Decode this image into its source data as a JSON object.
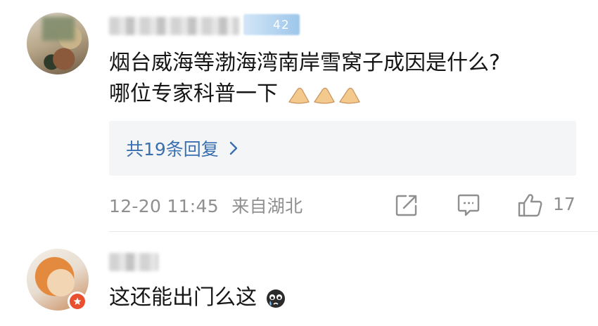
{
  "comments": [
    {
      "text_line1": "烟台威海等渤海湾南岸雪窝子成因是什么?",
      "text_line2": "哪位专家科普一下",
      "emoji": "pinched-hands-icon",
      "vip_level": "42",
      "replies_label": "共19条回复",
      "timestamp": "12-20 11:45",
      "location": "来自湖北",
      "like_count": "17"
    },
    {
      "text": "这还能出门么这",
      "emoji": "crying-face-icon"
    }
  ],
  "colors": {
    "link": "#3a6fb0",
    "meta": "#8f8f8f",
    "replies_bg": "#f4f5f7",
    "badge": "#e8502f"
  }
}
